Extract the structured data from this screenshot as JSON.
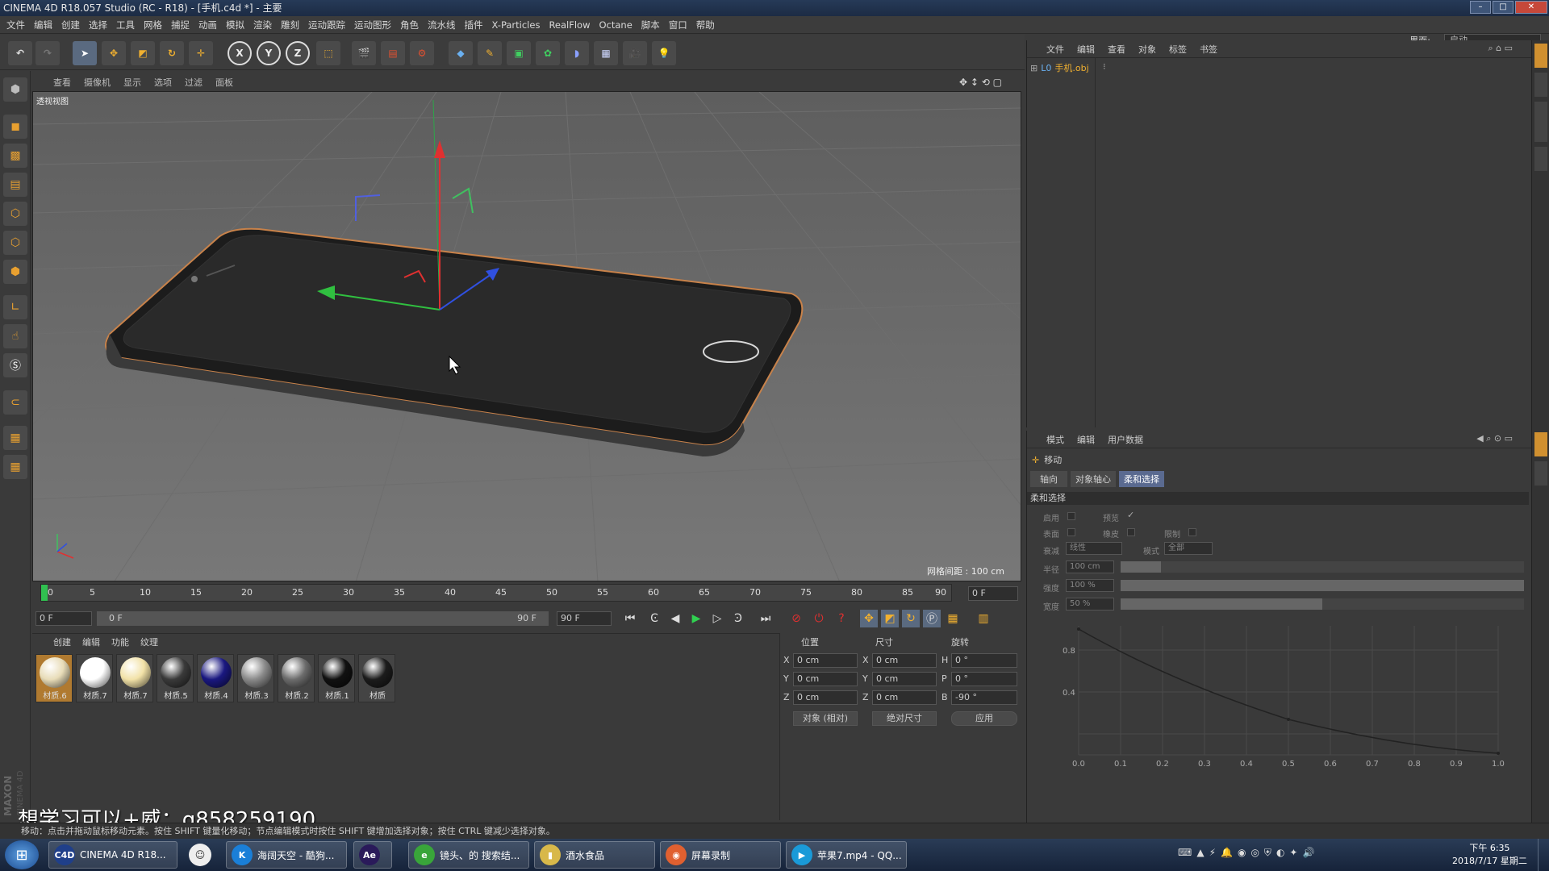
{
  "window": {
    "title": "CINEMA 4D R18.057 Studio (RC - R18) - [手机.c4d *] - 主要",
    "min": "–",
    "max": "□",
    "close": "✕"
  },
  "menu": [
    "文件",
    "编辑",
    "创建",
    "选择",
    "工具",
    "网格",
    "捕捉",
    "动画",
    "模拟",
    "渲染",
    "雕刻",
    "运动跟踪",
    "运动图形",
    "角色",
    "流水线",
    "插件",
    "X-Particles",
    "RealFlow",
    "Octane",
    "脚本",
    "窗口",
    "帮助"
  ],
  "interface": {
    "label": "界面:",
    "value": "启动"
  },
  "toolbar": {
    "x": "X",
    "y": "Y",
    "z": "Z"
  },
  "viewport": {
    "menu": [
      "查看",
      "摄像机",
      "显示",
      "选项",
      "过滤",
      "面板"
    ],
    "label": "透视视图",
    "grid_info": "网格间距 : 100 cm"
  },
  "timeline": {
    "ticks": [
      "0",
      "5",
      "10",
      "15",
      "20",
      "25",
      "30",
      "35",
      "40",
      "45",
      "50",
      "55",
      "60",
      "65",
      "70",
      "75",
      "80",
      "85",
      "90"
    ],
    "current": "0 F"
  },
  "transport": {
    "start": "0 F",
    "range_start": "0 F",
    "range_end": "90 F",
    "end": "90 F"
  },
  "materials": {
    "menu": [
      "创建",
      "编辑",
      "功能",
      "纹理"
    ],
    "items": [
      {
        "name": "材质.6",
        "color": "#e8dcb8"
      },
      {
        "name": "材质.7",
        "color": "#ffffff"
      },
      {
        "name": "材质.7",
        "color": "#f2e2a8"
      },
      {
        "name": "材质.5",
        "color": "#3a3a3a"
      },
      {
        "name": "材质.4",
        "color": "#1a1880"
      },
      {
        "name": "材质.3",
        "color": "#8a8a8a"
      },
      {
        "name": "材质.2",
        "color": "#6c6c6c"
      },
      {
        "name": "材质.1",
        "color": "#111111"
      },
      {
        "name": "材质",
        "color": "#1c1c1c"
      }
    ]
  },
  "coords": {
    "headers": [
      "位置",
      "尺寸",
      "旋转"
    ],
    "rows": [
      {
        "a": "X",
        "pos": "0 cm",
        "b": "X",
        "size": "0 cm",
        "c": "H",
        "rot": "0 °"
      },
      {
        "a": "Y",
        "pos": "0 cm",
        "b": "Y",
        "size": "0 cm",
        "c": "P",
        "rot": "0 °"
      },
      {
        "a": "Z",
        "pos": "0 cm",
        "b": "Z",
        "size": "0 cm",
        "c": "B",
        "rot": "-90 °"
      }
    ],
    "mode1": "对象 (相对)",
    "mode2": "绝对尺寸",
    "apply": "应用"
  },
  "objects": {
    "menu": [
      "文件",
      "编辑",
      "查看",
      "对象",
      "标签",
      "书签"
    ],
    "item": "手机.obj"
  },
  "attributes": {
    "menu": [
      "模式",
      "编辑",
      "用户数据"
    ],
    "tool": "移动",
    "tabs": [
      "轴向",
      "对象轴心",
      "柔和选择"
    ],
    "section": "柔和选择",
    "enable": "启用",
    "preview": "预览",
    "surface": "表面",
    "rubber": "橡皮",
    "restrict": "限制",
    "falloff_label": "衰减",
    "falloff_value": "线性",
    "mode_label": "模式",
    "mode_value": "全部",
    "radius_label": "半径",
    "radius_value": "100 cm",
    "strength_label": "强度",
    "strength_value": "100 %",
    "width_label": "宽度",
    "width_value": "50 %",
    "graph_x": [
      "0.0",
      "0.1",
      "0.2",
      "0.3",
      "0.4",
      "0.5",
      "0.6",
      "0.7",
      "0.8",
      "0.9",
      "1.0"
    ],
    "graph_y": [
      "0.8",
      "0.4"
    ]
  },
  "status": "移动：点击并拖动鼠标移动元素。按住 SHIFT 键量化移动；节点编辑模式时按住 SHIFT 键增加选择对象；按住 CTRL 键减少选择对象。",
  "watermark": "想学习可以+威：q858259190",
  "taskbar": {
    "tasks": [
      {
        "label": "CINEMA 4D R18...",
        "icon": "C4D",
        "color": "#1f3f8a"
      },
      {
        "label": "海阔天空 - 酷狗...",
        "icon": "K",
        "color": "#1a7fd8"
      },
      {
        "label": "Ae",
        "icon": "Ae",
        "color": "#2a1a5a"
      },
      {
        "label": "镜头、的 搜索结...",
        "icon": "e",
        "color": "#39a53a"
      },
      {
        "label": "酒水食品",
        "icon": "▮",
        "color": "#d8b84a"
      },
      {
        "label": "屏幕录制",
        "icon": "◉",
        "color": "#e06030"
      },
      {
        "label": "苹果7.mp4 - QQ...",
        "icon": "▶",
        "color": "#1a9ad8"
      }
    ],
    "time": "下午 6:35",
    "date": "2018/7/17 星期二"
  }
}
